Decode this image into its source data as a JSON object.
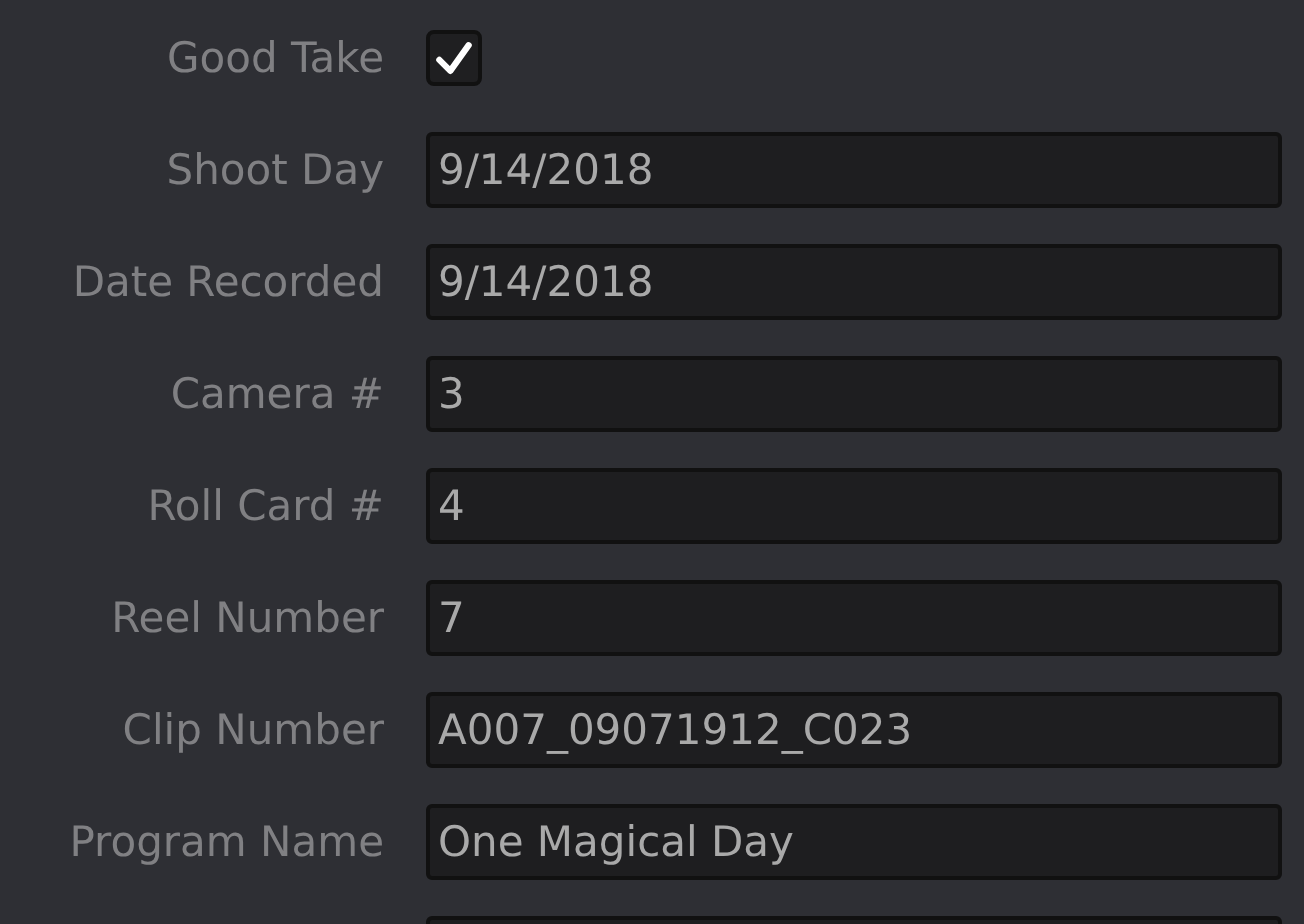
{
  "fields": [
    {
      "kind": "checkbox",
      "label": "Good Take",
      "checked": true
    },
    {
      "kind": "field",
      "label": "Shoot Day",
      "value": "9/14/2018"
    },
    {
      "kind": "field",
      "label": "Date Recorded",
      "value": "9/14/2018"
    },
    {
      "kind": "field",
      "label": "Camera #",
      "value": "3"
    },
    {
      "kind": "field",
      "label": "Roll Card #",
      "value": "4"
    },
    {
      "kind": "field",
      "label": "Reel Number",
      "value": "7"
    },
    {
      "kind": "field",
      "label": "Clip Number",
      "value": "A007_09071912_C023"
    },
    {
      "kind": "field",
      "label": "Program Name",
      "value": "One Magical Day"
    },
    {
      "kind": "field"
    }
  ]
}
